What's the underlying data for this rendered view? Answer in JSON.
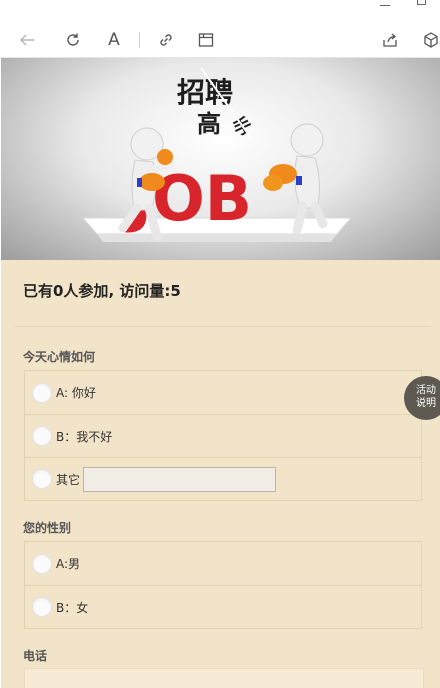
{
  "toolbar": {
    "buttons": [
      {
        "name": "back-icon"
      },
      {
        "name": "refresh-icon"
      },
      {
        "name": "read-mode-icon",
        "glyph": "A"
      },
      {
        "name": "link-icon"
      },
      {
        "name": "window-icon"
      },
      {
        "name": "share-icon"
      },
      {
        "name": "package-icon"
      }
    ]
  },
  "banner": {
    "title_top": "招聘",
    "title_bottom": "高",
    "title_side": "手",
    "word": "JOB"
  },
  "stats": "已有0人参加, 访问量:5",
  "q1": {
    "title": "今天心情如何",
    "options": [
      "A: 你好",
      "B：我不好",
      "其它"
    ]
  },
  "q2": {
    "title": "您的性别",
    "options": [
      "A:男",
      "B：女"
    ]
  },
  "q3": {
    "title": "电话"
  },
  "fab": {
    "line1": "活动",
    "line2": "说明"
  },
  "colors": {
    "content_bg": "#f2e4c9",
    "fab_bg": "#5e5a52",
    "job_red": "#d8242b",
    "glove_orange": "#f08a1c"
  }
}
